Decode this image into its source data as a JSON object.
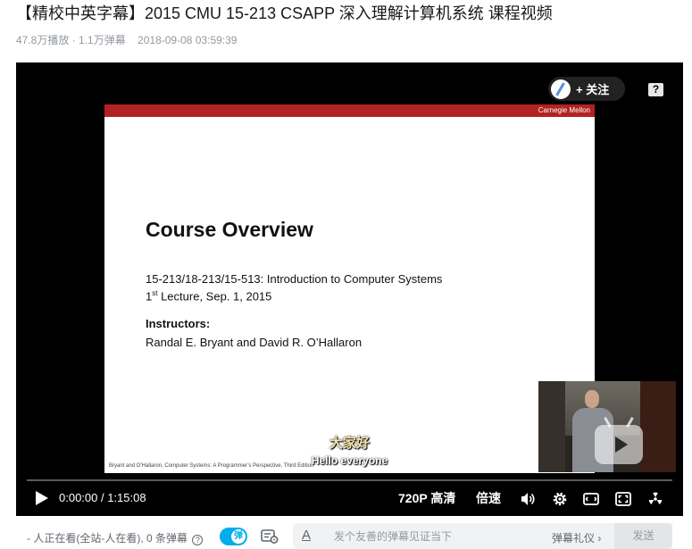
{
  "video": {
    "title": "【精校中英字幕】2015 CMU 15-213 CSAPP 深入理解计算机系统 课程视频",
    "stats": "47.8万播放 · 1.1万弹幕",
    "date": "2018-09-08 03:59:39"
  },
  "player": {
    "follow_label": "+ 关注",
    "help_glyph": "?",
    "slide": {
      "brand": "Carnegie Mellon",
      "heading": "Course Overview",
      "line1": "15-213/18-213/15-513: Introduction to Computer Systems",
      "line2_prefix": "1",
      "line2_sup": "st",
      "line2_rest": " Lecture, Sep. 1, 2015",
      "instructors_label": "Instructors:",
      "instructors": "Randal E. Bryant and David R. O’Hallaron",
      "footer": "Bryant and O’Hallaron, Computer Systems: A Programmer’s Perspective, Third Edition"
    },
    "subtitle_cn": "大家好",
    "subtitle_en": "Hello everyone",
    "progress": 0,
    "controls": {
      "time": "0:00:00 / 1:15:08",
      "quality": "720P 高清",
      "speed": "倍速"
    },
    "icons": [
      "play-icon",
      "volume-icon",
      "settings-icon",
      "widescreen-icon",
      "fullscreen-icon",
      "radiation-icon"
    ]
  },
  "bottom_bar": {
    "viewers": "- 人正在看(全站-人在看), 0 条弹幕",
    "info_glyph": "?",
    "toggle_glyph": "弹",
    "font_glyph": "A",
    "input_placeholder": "发个友善的弹幕见证当下",
    "etiquette": "弹幕礼仪 ›",
    "send_label": "发送"
  },
  "colors": {
    "accent": "#00aeec",
    "slide_bar": "#b22222",
    "subtitle_cn": "#f4e3a8"
  }
}
